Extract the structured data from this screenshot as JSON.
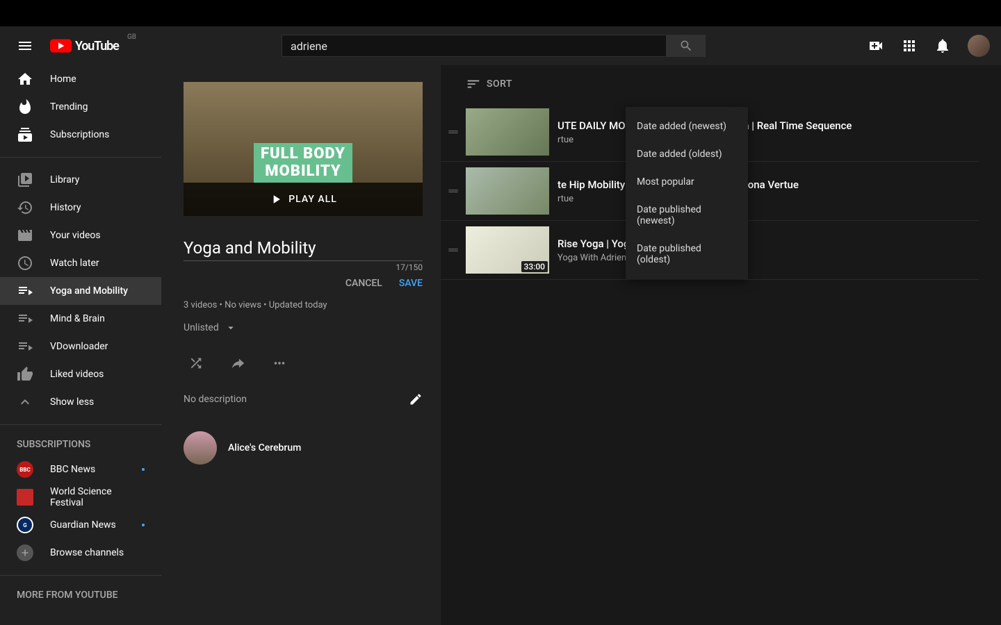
{
  "header": {
    "search_value": "adriene",
    "logo_region": "GB"
  },
  "sidebar": {
    "primary": [
      {
        "label": "Home",
        "icon": "home",
        "active": false
      },
      {
        "label": "Trending",
        "icon": "fire",
        "active": false
      },
      {
        "label": "Subscriptions",
        "icon": "subs",
        "active": false
      }
    ],
    "library": [
      {
        "label": "Library",
        "icon": "library"
      },
      {
        "label": "History",
        "icon": "history"
      },
      {
        "label": "Your videos",
        "icon": "yourvids"
      },
      {
        "label": "Watch later",
        "icon": "clock"
      },
      {
        "label": "Yoga and Mobility",
        "icon": "playlist",
        "active": true
      },
      {
        "label": "Mind & Brain",
        "icon": "playlist"
      },
      {
        "label": "VDownloader",
        "icon": "playlist"
      },
      {
        "label": "Liked videos",
        "icon": "thumb"
      },
      {
        "label": "Show less",
        "icon": "chevup"
      }
    ],
    "subs_title": "SUBSCRIPTIONS",
    "subscriptions": [
      {
        "label": "BBC News",
        "color": "#bb1919",
        "dot": true,
        "short": "BBC"
      },
      {
        "label": "World Science Festival",
        "color": "#c62828",
        "dot": false,
        "short": ""
      },
      {
        "label": "Guardian News",
        "color": "#052962",
        "dot": true,
        "short": "G"
      },
      {
        "label": "Browse channels",
        "icon": "plus"
      }
    ],
    "more_title": "MORE FROM YOUTUBE"
  },
  "playlist": {
    "thumb_text_1": "FULL BODY",
    "thumb_text_2": "MOBILITY",
    "play_all": "PLAY ALL",
    "title_value": "Yoga and Mobility",
    "title_count": "17/150",
    "cancel": "CANCEL",
    "save": "SAVE",
    "meta": "3 videos • No views • Updated today",
    "visibility": "Unlisted",
    "description_placeholder": "No description",
    "owner": "Alice's Cerebrum"
  },
  "sort": {
    "label": "SORT",
    "options": [
      "Date added (newest)",
      "Date added (oldest)",
      "Most popular",
      "Date published (newest)",
      "Date published (oldest)"
    ]
  },
  "videos": [
    {
      "title": "UTE DAILY MOBILITY ROUTINE | No Yoga | Real Time Sequence",
      "channel": "rtue",
      "duration": ""
    },
    {
      "title": "te Hip Mobility Sequence | Real Time | Shona Vertue",
      "channel": "rtue",
      "duration": ""
    },
    {
      "title": "Rise Yoga | Yoga With Adriene",
      "channel": "Yoga With Adriene",
      "duration": "33:00"
    }
  ]
}
